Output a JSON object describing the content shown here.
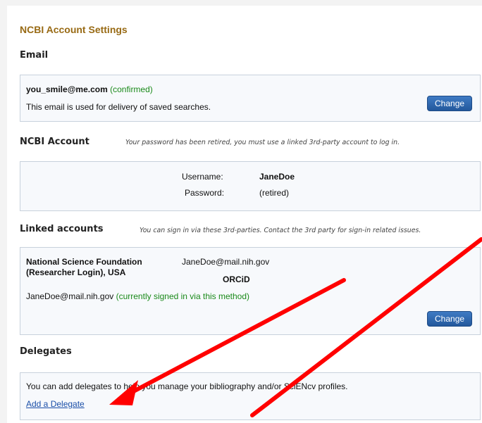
{
  "page_title": "NCBI Account Settings",
  "email_section": {
    "heading": "Email",
    "address": "you_smile@me.com",
    "status": "(confirmed)",
    "description": "This email is used for delivery of saved searches.",
    "change_label": "Change"
  },
  "account_section": {
    "heading": "NCBI Account",
    "note": "Your password has been retired, you must use a linked 3rd-party account to log in.",
    "username_label": "Username:",
    "username_value": "JaneDoe",
    "password_label": "Password:",
    "password_value": "(retired)"
  },
  "linked_section": {
    "heading": "Linked accounts",
    "note": "You can sign in via these 3rd-parties. Contact the 3rd party for sign-in related issues.",
    "provider_line1": "National Science Foundation",
    "provider_line2": "(Researcher Login), USA",
    "provider_email": "JaneDoe@mail.nih.gov",
    "orcid_label": "ORCiD",
    "signed_in_email": "JaneDoe@mail.nih.gov",
    "signed_in_status": "(currently signed in via this method)",
    "change_label": "Change"
  },
  "delegates_section": {
    "heading": "Delegates",
    "description": "You can add delegates to help you manage your bibliography and/or SciENcv profiles.",
    "add_link": "Add a Delegate"
  },
  "colors": {
    "title": "#986a14",
    "button": "#2b63a8",
    "confirmed": "#1a8a1a",
    "annotation_arrow": "#ff0000"
  }
}
